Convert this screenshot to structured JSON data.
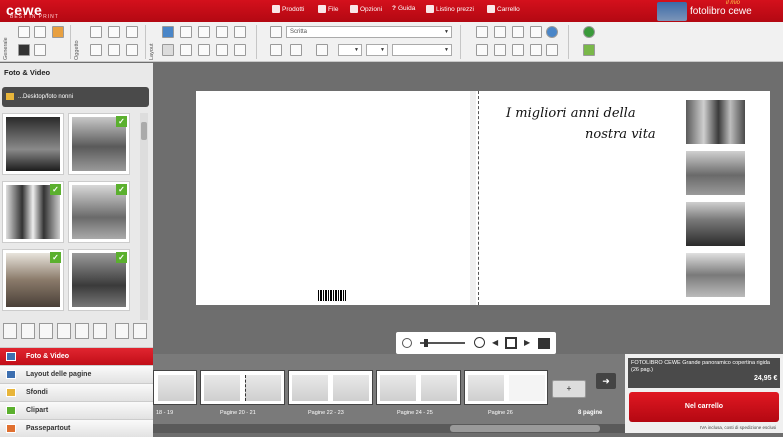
{
  "header": {
    "logo": "cewe",
    "logo_tagline": "BEST IN PRINT",
    "menu": [
      "Prodotti",
      "File",
      "Opzioni",
      "Guida",
      "Listino prezzi",
      "Carrello"
    ],
    "brand": "fotolibro cewe",
    "brand_accent": "il mio"
  },
  "toolbar": {
    "group1_label": "Generale",
    "group2_label": "Oggetto",
    "group3_label": "Layout",
    "font_placeholder": "Scritta",
    "colors": {
      "accent": "#c40d18",
      "toolbar_bg": "#f1f1f1"
    }
  },
  "left_panel": {
    "title": "Foto & Video",
    "path": "...Desktop/foto nonni",
    "nav": [
      {
        "label": "Foto & Video",
        "icon": "photo-icon",
        "active": true
      },
      {
        "label": "Layout delle pagine",
        "icon": "layout-icon",
        "active": false
      },
      {
        "label": "Sfondi",
        "icon": "background-icon",
        "active": false
      },
      {
        "label": "Clipart",
        "icon": "clipart-icon",
        "active": false
      },
      {
        "label": "Passepartout",
        "icon": "passepartout-icon",
        "active": false
      }
    ]
  },
  "canvas": {
    "title_line1": "I migliori anni della",
    "title_line2": "nostra vita"
  },
  "filmstrip": {
    "spreads": [
      "18 - 19",
      "Pagine 20 - 21",
      "Pagine 22 - 23",
      "Pagine 24 - 25",
      "Pagine 26"
    ],
    "pages_count": "8 pagine",
    "add_label": "+"
  },
  "product": {
    "description": "FOTOLIBRO CEWE Grande panoramico copertina rigida (26 pag.)",
    "price": "24,95 €",
    "cart_button": "Nel carrello",
    "vat_note": "IVA inclusa, costi di spedizione esclusi"
  }
}
